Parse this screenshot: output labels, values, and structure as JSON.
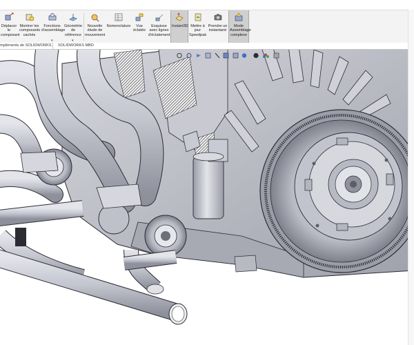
{
  "ribbon": {
    "buttons": [
      {
        "id": "deplacer",
        "label": "Déplacer le composant",
        "icon": "move-component-icon",
        "active": false
      },
      {
        "id": "montrer",
        "label": "Montrer les composants cachés",
        "icon": "show-hidden-icon",
        "active": false
      },
      {
        "id": "fonctions",
        "label": "Fonctions d'assemblage",
        "icon": "assembly-features-icon",
        "active": false,
        "has_dropdown": true
      },
      {
        "id": "geometrie",
        "label": "Géométrie de référence",
        "icon": "reference-geometry-icon",
        "active": false,
        "has_dropdown": true
      },
      {
        "id": "etude",
        "label": "Nouvelle étude de mouvement",
        "icon": "motion-study-icon",
        "active": false
      },
      {
        "id": "nomenclature",
        "label": "Nomenclature",
        "icon": "bill-of-materials-icon",
        "active": false
      },
      {
        "id": "vue",
        "label": "Vue éclatée",
        "icon": "exploded-view-icon",
        "active": false
      },
      {
        "id": "esquisse",
        "label": "Esquisse avec lignes d'éclatement",
        "icon": "explode-line-sketch-icon",
        "active": false
      },
      {
        "id": "instant3d",
        "label": "Instant3D",
        "icon": "instant3d-icon",
        "active": true
      },
      {
        "id": "speedpak",
        "label": "Mettre à jour Speedpak",
        "icon": "speedpak-icon",
        "active": false
      },
      {
        "id": "snapshot",
        "label": "Prendre un instantané",
        "icon": "camera-icon",
        "active": false
      },
      {
        "id": "largeassembly",
        "label": "Mode Assemblage complexe",
        "icon": "large-assembly-icon",
        "active": true
      }
    ]
  },
  "tabs": [
    {
      "label": "mpléments de SOLIDWORKS"
    },
    {
      "label": "SOLIDWORKS MBD"
    }
  ],
  "heads_up_toolbar": {
    "icons": [
      "zoom-fit-icon",
      "zoom-area-icon",
      "previous-view-icon",
      "section-view-icon",
      "dynamic-annotation-icon",
      "view-orientation-icon",
      "display-style-icon",
      "hide-show-icon",
      "edit-appearance-icon",
      "apply-scene-icon",
      "view-settings-icon"
    ]
  },
  "colors": {
    "ribbon_bg": "#f3f3f3",
    "active_bg": "#cfcfcf",
    "model_metal": "#c9cbd4",
    "model_shadow": "#8a8c96",
    "model_edge": "#2b2b33"
  }
}
